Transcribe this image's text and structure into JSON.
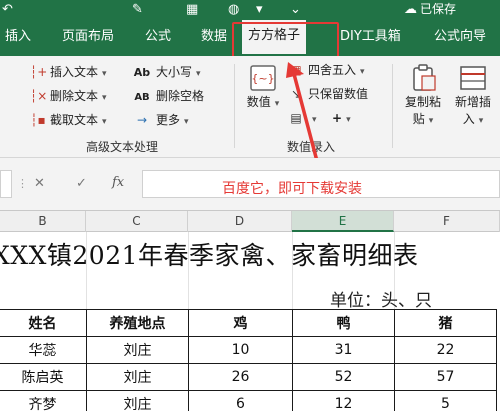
{
  "titlebar": {
    "status": "已保存"
  },
  "tabs": [
    {
      "label": "插入"
    },
    {
      "label": "页面布局"
    },
    {
      "label": "公式"
    },
    {
      "label": "数据"
    },
    {
      "label": "方方格子"
    },
    {
      "label": "DIY工具箱"
    },
    {
      "label": "公式向导"
    }
  ],
  "ribbon": {
    "text_group": {
      "insert_text": "插入文本",
      "delete_text": "删除文本",
      "extract_text": "截取文本",
      "case": "大小写",
      "delete_space": "删除空格",
      "more": "更多",
      "case_icon": "Ab",
      "space_icon": "AB",
      "label": "高级文本处理"
    },
    "number_group": {
      "value_btn": "数值",
      "round": "四舍五入",
      "keep_value": "只保留数值",
      "label": "数值录入"
    },
    "copy_paste": [
      "复制粘",
      "贴"
    ],
    "insert_new": [
      "新增插",
      "入"
    ]
  },
  "formula_bar": {
    "fx": "fx",
    "cancel": "✕",
    "confirm": "✓"
  },
  "annotation": "百度它，即可下载安装",
  "columns": [
    "B",
    "C",
    "D",
    "E",
    "F"
  ],
  "sheet": {
    "title": "XXX镇2021年春季家禽、家畜明细表",
    "unit": "单位：头、只",
    "headers": [
      "姓名",
      "养殖地点",
      "鸡",
      "鸭",
      "猪"
    ],
    "rows": [
      [
        "华蕊",
        "刘庄",
        "10",
        "31",
        "22"
      ],
      [
        "陈启英",
        "刘庄",
        "26",
        "52",
        "57"
      ],
      [
        "齐梦",
        "刘庄",
        "6",
        "12",
        "5"
      ]
    ]
  },
  "colors": {
    "ribbon_green": "#217346",
    "annotation_red": "#e53935"
  }
}
